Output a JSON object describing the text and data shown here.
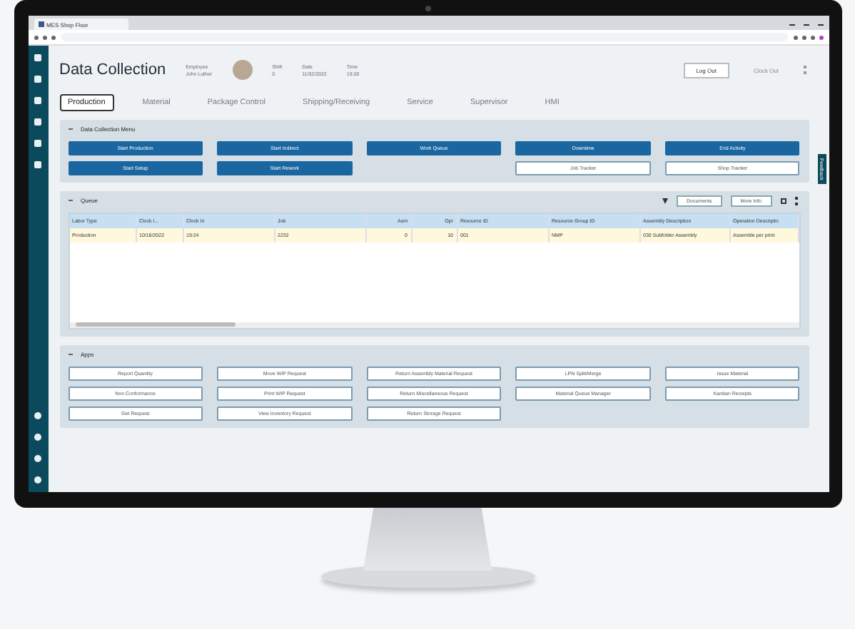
{
  "browser": {
    "tab_title": "MES Shop Floor"
  },
  "header": {
    "title": "Data Collection",
    "fields": [
      {
        "label": "Employee",
        "value": "John Luther"
      },
      {
        "label": "Shift",
        "value": "0"
      },
      {
        "label": "Date",
        "value": "11/02/2022"
      },
      {
        "label": "Time",
        "value": "19:28"
      }
    ],
    "buttons": [
      {
        "label": "Log Out",
        "kind": "outline"
      },
      {
        "label": "Clock Out",
        "kind": "plain"
      }
    ]
  },
  "tabs": [
    {
      "label": "Production",
      "selected": true
    },
    {
      "label": "Material",
      "selected": false
    },
    {
      "label": "Package Control",
      "selected": false
    },
    {
      "label": "Shipping/Receiving",
      "selected": false
    },
    {
      "label": "Service",
      "selected": false
    },
    {
      "label": "Supervisor",
      "selected": false
    },
    {
      "label": "HMI",
      "selected": false
    }
  ],
  "menu": {
    "title": "Data Collection Menu",
    "buttons": [
      {
        "label": "Start Production",
        "kind": "primary"
      },
      {
        "label": "Start Indirect",
        "kind": "primary"
      },
      {
        "label": "Work Queue",
        "kind": "primary"
      },
      {
        "label": "Downtime",
        "kind": "primary"
      },
      {
        "label": "End Activity",
        "kind": "primary"
      },
      {
        "label": "Start Setup",
        "kind": "primary"
      },
      {
        "label": "Start Rework",
        "kind": "primary"
      },
      {
        "kind": "empty"
      },
      {
        "label": "Job Tracker",
        "kind": "outline"
      },
      {
        "label": "Shop Tracker",
        "kind": "outline"
      }
    ]
  },
  "queue": {
    "title": "Queue",
    "buttons": [
      "Documents",
      "More Info"
    ],
    "columns": [
      {
        "label": "Labor Type",
        "kind": "text"
      },
      {
        "label": "Clock I...",
        "kind": "text"
      },
      {
        "label": "Clock In",
        "kind": "text"
      },
      {
        "label": "Job",
        "kind": "text"
      },
      {
        "label": "Asm",
        "kind": "number"
      },
      {
        "label": "Opr",
        "kind": "number"
      },
      {
        "label": "Resource ID",
        "kind": "text"
      },
      {
        "label": "Resource Group ID",
        "kind": "text"
      },
      {
        "label": "Assembly Description",
        "kind": "text"
      },
      {
        "label": "Operation Descriptio",
        "kind": "text"
      }
    ],
    "rows": [
      {
        "selected": true,
        "cells": [
          "Production",
          "10/18/2022",
          "19:24",
          "2232",
          "0",
          "10",
          "001",
          "NMP",
          "030 Subfolder Assembly",
          "Assemble per print"
        ]
      }
    ]
  },
  "apps": {
    "title": "Apps",
    "buttons": [
      "Report Quantity",
      "Move WIP Request",
      "Return Assembly Material Request",
      "LPN Split/Merge",
      "Issue Material",
      "Non Conformance",
      "Print WIP Request",
      "Return Miscellaneous Request",
      "Material Queue Manager",
      "Kanban Receipts",
      "Get Request",
      "View Inventory Request",
      "Return Storage Request"
    ]
  },
  "feedback": "Feedback"
}
